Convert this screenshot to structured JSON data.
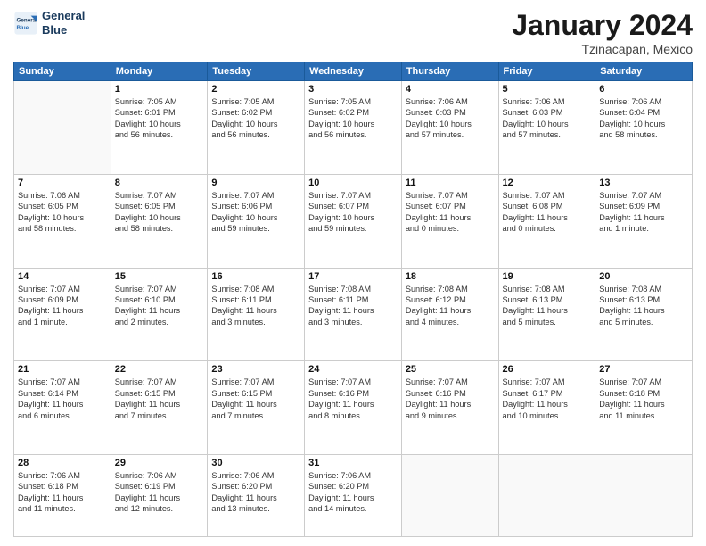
{
  "logo": {
    "line1": "General",
    "line2": "Blue"
  },
  "title": "January 2024",
  "subtitle": "Tzinacapan, Mexico",
  "days_of_week": [
    "Sunday",
    "Monday",
    "Tuesday",
    "Wednesday",
    "Thursday",
    "Friday",
    "Saturday"
  ],
  "weeks": [
    [
      {
        "day": "",
        "info": ""
      },
      {
        "day": "1",
        "info": "Sunrise: 7:05 AM\nSunset: 6:01 PM\nDaylight: 10 hours\nand 56 minutes."
      },
      {
        "day": "2",
        "info": "Sunrise: 7:05 AM\nSunset: 6:02 PM\nDaylight: 10 hours\nand 56 minutes."
      },
      {
        "day": "3",
        "info": "Sunrise: 7:05 AM\nSunset: 6:02 PM\nDaylight: 10 hours\nand 56 minutes."
      },
      {
        "day": "4",
        "info": "Sunrise: 7:06 AM\nSunset: 6:03 PM\nDaylight: 10 hours\nand 57 minutes."
      },
      {
        "day": "5",
        "info": "Sunrise: 7:06 AM\nSunset: 6:03 PM\nDaylight: 10 hours\nand 57 minutes."
      },
      {
        "day": "6",
        "info": "Sunrise: 7:06 AM\nSunset: 6:04 PM\nDaylight: 10 hours\nand 58 minutes."
      }
    ],
    [
      {
        "day": "7",
        "info": "Sunrise: 7:06 AM\nSunset: 6:05 PM\nDaylight: 10 hours\nand 58 minutes."
      },
      {
        "day": "8",
        "info": "Sunrise: 7:07 AM\nSunset: 6:05 PM\nDaylight: 10 hours\nand 58 minutes."
      },
      {
        "day": "9",
        "info": "Sunrise: 7:07 AM\nSunset: 6:06 PM\nDaylight: 10 hours\nand 59 minutes."
      },
      {
        "day": "10",
        "info": "Sunrise: 7:07 AM\nSunset: 6:07 PM\nDaylight: 10 hours\nand 59 minutes."
      },
      {
        "day": "11",
        "info": "Sunrise: 7:07 AM\nSunset: 6:07 PM\nDaylight: 11 hours\nand 0 minutes."
      },
      {
        "day": "12",
        "info": "Sunrise: 7:07 AM\nSunset: 6:08 PM\nDaylight: 11 hours\nand 0 minutes."
      },
      {
        "day": "13",
        "info": "Sunrise: 7:07 AM\nSunset: 6:09 PM\nDaylight: 11 hours\nand 1 minute."
      }
    ],
    [
      {
        "day": "14",
        "info": "Sunrise: 7:07 AM\nSunset: 6:09 PM\nDaylight: 11 hours\nand 1 minute."
      },
      {
        "day": "15",
        "info": "Sunrise: 7:07 AM\nSunset: 6:10 PM\nDaylight: 11 hours\nand 2 minutes."
      },
      {
        "day": "16",
        "info": "Sunrise: 7:08 AM\nSunset: 6:11 PM\nDaylight: 11 hours\nand 3 minutes."
      },
      {
        "day": "17",
        "info": "Sunrise: 7:08 AM\nSunset: 6:11 PM\nDaylight: 11 hours\nand 3 minutes."
      },
      {
        "day": "18",
        "info": "Sunrise: 7:08 AM\nSunset: 6:12 PM\nDaylight: 11 hours\nand 4 minutes."
      },
      {
        "day": "19",
        "info": "Sunrise: 7:08 AM\nSunset: 6:13 PM\nDaylight: 11 hours\nand 5 minutes."
      },
      {
        "day": "20",
        "info": "Sunrise: 7:08 AM\nSunset: 6:13 PM\nDaylight: 11 hours\nand 5 minutes."
      }
    ],
    [
      {
        "day": "21",
        "info": "Sunrise: 7:07 AM\nSunset: 6:14 PM\nDaylight: 11 hours\nand 6 minutes."
      },
      {
        "day": "22",
        "info": "Sunrise: 7:07 AM\nSunset: 6:15 PM\nDaylight: 11 hours\nand 7 minutes."
      },
      {
        "day": "23",
        "info": "Sunrise: 7:07 AM\nSunset: 6:15 PM\nDaylight: 11 hours\nand 7 minutes."
      },
      {
        "day": "24",
        "info": "Sunrise: 7:07 AM\nSunset: 6:16 PM\nDaylight: 11 hours\nand 8 minutes."
      },
      {
        "day": "25",
        "info": "Sunrise: 7:07 AM\nSunset: 6:16 PM\nDaylight: 11 hours\nand 9 minutes."
      },
      {
        "day": "26",
        "info": "Sunrise: 7:07 AM\nSunset: 6:17 PM\nDaylight: 11 hours\nand 10 minutes."
      },
      {
        "day": "27",
        "info": "Sunrise: 7:07 AM\nSunset: 6:18 PM\nDaylight: 11 hours\nand 11 minutes."
      }
    ],
    [
      {
        "day": "28",
        "info": "Sunrise: 7:06 AM\nSunset: 6:18 PM\nDaylight: 11 hours\nand 11 minutes."
      },
      {
        "day": "29",
        "info": "Sunrise: 7:06 AM\nSunset: 6:19 PM\nDaylight: 11 hours\nand 12 minutes."
      },
      {
        "day": "30",
        "info": "Sunrise: 7:06 AM\nSunset: 6:20 PM\nDaylight: 11 hours\nand 13 minutes."
      },
      {
        "day": "31",
        "info": "Sunrise: 7:06 AM\nSunset: 6:20 PM\nDaylight: 11 hours\nand 14 minutes."
      },
      {
        "day": "",
        "info": ""
      },
      {
        "day": "",
        "info": ""
      },
      {
        "day": "",
        "info": ""
      }
    ]
  ]
}
